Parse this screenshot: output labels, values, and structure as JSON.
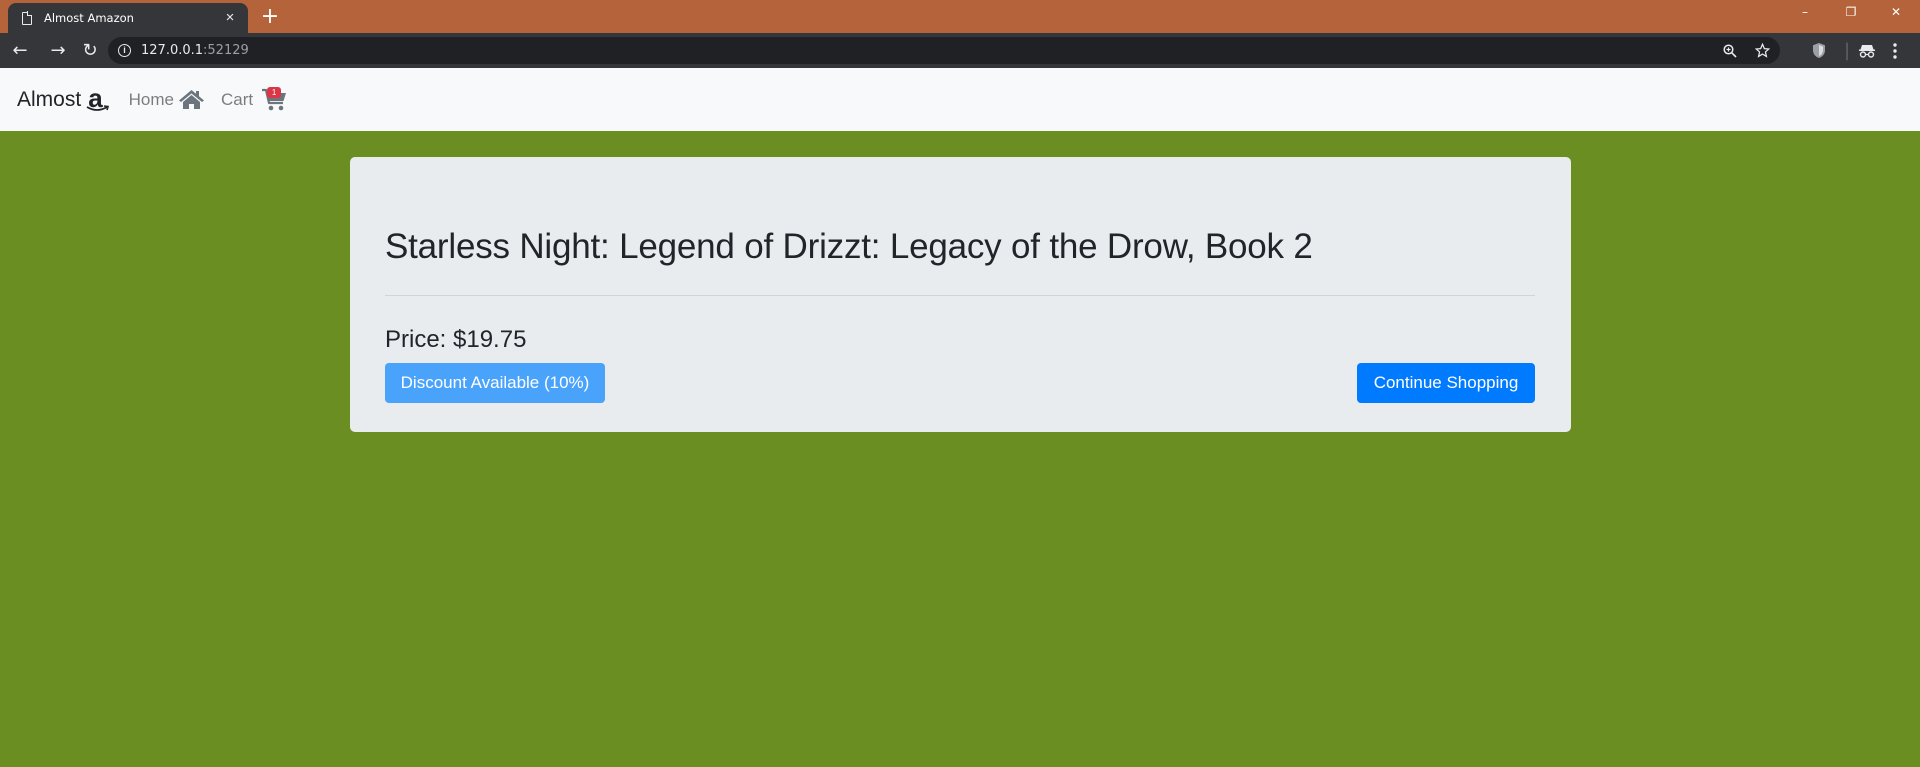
{
  "browser": {
    "tab_title": "Almost Amazon",
    "tab_close": "×",
    "new_tab": "+",
    "url_host": "127.0.0.1",
    "url_port": ":52129",
    "window_controls": {
      "minimize": "–",
      "restore": "❐",
      "close": "✕"
    },
    "nav": {
      "back": "←",
      "forward": "→",
      "reload": "↻"
    },
    "icons": [
      "zoom-icon",
      "star-icon",
      "shield-extension-icon",
      "incognito-icon",
      "menu-icon"
    ]
  },
  "navbar": {
    "brand": "Almost",
    "brand_logo": "a",
    "home_label": "Home",
    "cart_label": "Cart",
    "cart_count": "1"
  },
  "book": {
    "title": "Starless Night: Legend of Drizzt: Legacy of the Drow, Book 2",
    "price": "Price: $19.75",
    "discount_label": "Discount Available (10%)",
    "continue_label": "Continue Shopping"
  },
  "colors": {
    "page_background": "#6b8e23",
    "tab_strip": "#b5633a",
    "primary_button": "#007bff",
    "discount_button": "#4aa3fb"
  }
}
